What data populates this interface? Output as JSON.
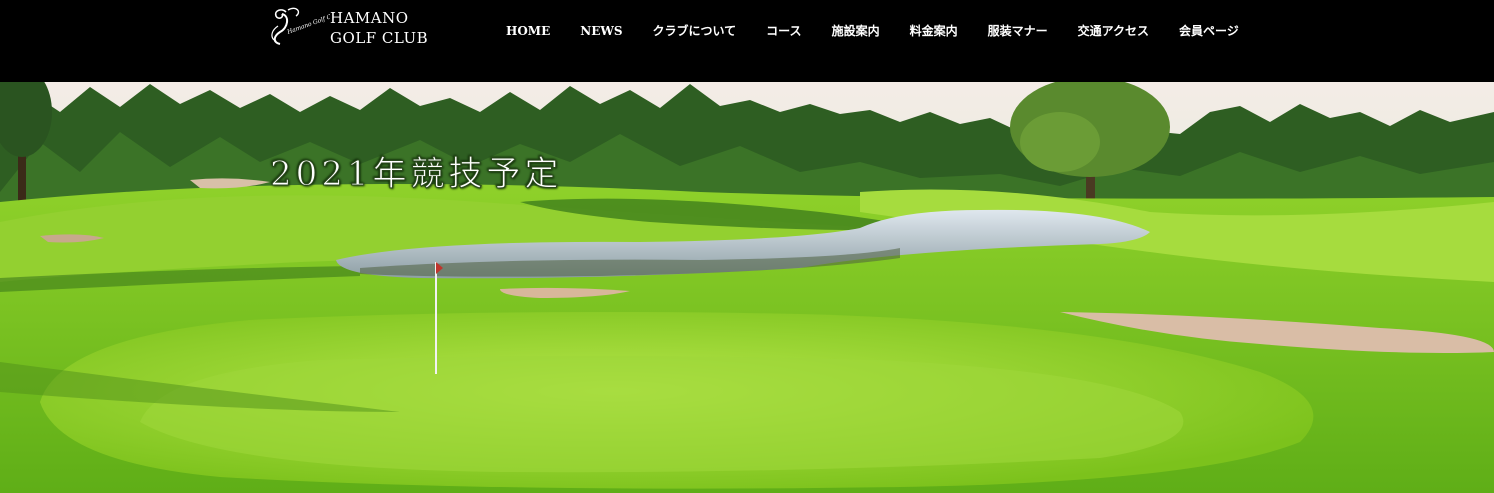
{
  "brand": {
    "logo_script": "Hamano Golf Club",
    "name_line1": "HAMANO",
    "name_line2": "GOLF CLUB"
  },
  "nav": {
    "items": [
      {
        "label": "HOME",
        "name": "nav-home"
      },
      {
        "label": "NEWS",
        "name": "nav-news"
      },
      {
        "label": "クラブについて",
        "name": "nav-about-club"
      },
      {
        "label": "コース",
        "name": "nav-course"
      },
      {
        "label": "施設案内",
        "name": "nav-facilities"
      },
      {
        "label": "料金案内",
        "name": "nav-fees"
      },
      {
        "label": "服装マナー",
        "name": "nav-dress-code"
      },
      {
        "label": "交通アクセス",
        "name": "nav-access"
      },
      {
        "label": "会員ページ",
        "name": "nav-members"
      }
    ]
  },
  "hero": {
    "title": "2021年競技予定",
    "image": "golf-course-green-with-pond-photo"
  },
  "colors": {
    "header_bg": "#000000",
    "nav_text": "#ffffff",
    "grass": "#7cc21c",
    "sky": "#f3ece4"
  }
}
